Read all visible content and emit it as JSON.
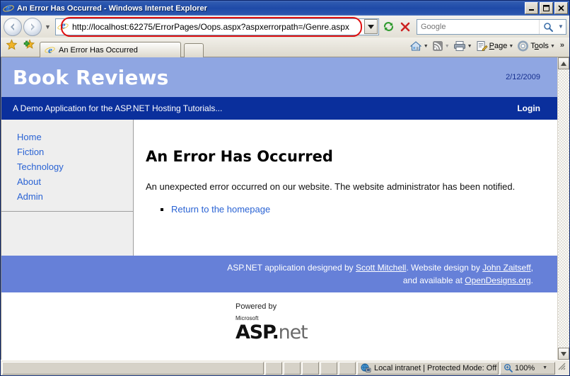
{
  "window": {
    "title": "An Error Has Occurred - Windows Internet Explorer",
    "minimize_label": "Minimize",
    "maximize_label": "Maximize",
    "close_label": "Close"
  },
  "browser": {
    "back_label": "Back",
    "forward_label": "Forward",
    "recent_pages_label": "Recent Pages",
    "address_value": "http://localhost:62275/ErrorPages/Oops.aspx?aspxerrorpath=/Genre.aspx",
    "address_dropdown_label": "Address dropdown",
    "refresh_label": "Refresh",
    "stop_label": "Stop",
    "search_placeholder": "Google",
    "search_go_label": "Search",
    "search_dropdown_label": "Search provider dropdown",
    "favorites_center_label": "Favorites Center",
    "add_favorites_label": "Add to Favorites",
    "tab_title": "An Error Has Occurred",
    "new_tab_label": "New Tab",
    "toolbar": [
      {
        "name": "home",
        "label": "",
        "caret": true
      },
      {
        "name": "feeds",
        "label": "",
        "caret": true
      },
      {
        "name": "print",
        "label": "",
        "caret": true
      },
      {
        "name": "page",
        "label": "Page",
        "caret": true
      },
      {
        "name": "tools",
        "label": "Tools",
        "caret": true
      }
    ],
    "toolbar_overflow": "»",
    "page_label": "Page",
    "tools_label": "Tools"
  },
  "site": {
    "title": "Book Reviews",
    "date": "2/12/2009",
    "tagline": "A Demo Application for the ASP.NET Hosting Tutorials...",
    "login_label": "Login",
    "nav_items": [
      {
        "label": "Home"
      },
      {
        "label": "Fiction"
      },
      {
        "label": "Technology"
      },
      {
        "label": "About"
      },
      {
        "label": "Admin"
      }
    ]
  },
  "content": {
    "heading": "An Error Has Occurred",
    "paragraph": "An unexpected error occurred on our website. The website administrator has been notified.",
    "link_label": "Return to the homepage"
  },
  "footer": {
    "line1_prefix": "ASP.NET application designed by ",
    "link1": "Scott Mitchell",
    "line1_mid": ". Website design by ",
    "link2": "John Zaitseff",
    "line1_suffix": ",",
    "line2_prefix": "and available at ",
    "link3": "OpenDesigns.org",
    "line2_suffix": "."
  },
  "powered": {
    "top": "Powered by",
    "microsoft": "Microsoft",
    "asp": "ASP",
    "dot": ".",
    "n": "n",
    "e": "e",
    "t": "t"
  },
  "status": {
    "zone": "Local intranet | Protected Mode: Off",
    "zoom": "100%",
    "zoom_dropdown_label": "Zoom level dropdown"
  },
  "colors": {
    "titlebar": "#1f4aa8",
    "site_header": "#8fa6e2",
    "site_nav": "#0a2f9c",
    "footer": "#6680d8",
    "link": "#2a63d4",
    "highlight": "#e01010",
    "sidebar": "#eeeeee"
  }
}
